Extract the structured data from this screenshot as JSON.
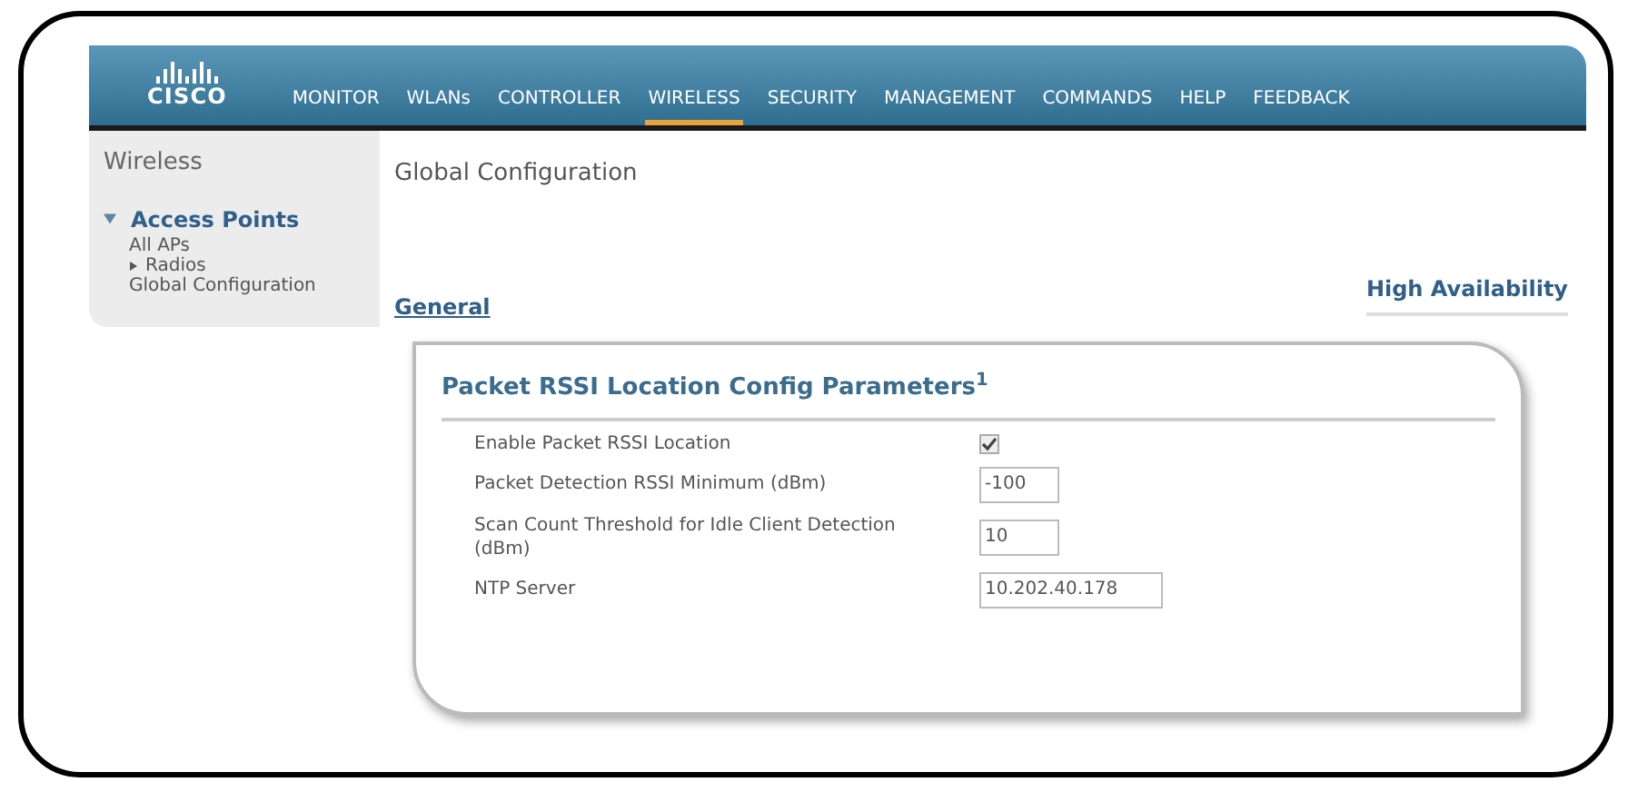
{
  "header": {
    "logo": "CISCO",
    "nav": [
      {
        "label": "MONITOR",
        "selected": false
      },
      {
        "label": "WLANs",
        "selected": false
      },
      {
        "label": "CONTROLLER",
        "selected": false
      },
      {
        "label": "WIRELESS",
        "selected": true
      },
      {
        "label": "SECURITY",
        "selected": false
      },
      {
        "label": "MANAGEMENT",
        "selected": false
      },
      {
        "label": "COMMANDS",
        "selected": false
      },
      {
        "label": "HELP",
        "selected": false
      },
      {
        "label": "FEEDBACK",
        "selected": false
      }
    ]
  },
  "sidebar": {
    "title": "Wireless",
    "items": [
      {
        "label": "Access Points",
        "expanded": true,
        "children": [
          {
            "label": "All APs"
          },
          {
            "label": "Radios",
            "expanded": false
          },
          {
            "label": "Global Configuration"
          }
        ]
      }
    ]
  },
  "page_title": "Global Configuration",
  "section_tabs": [
    {
      "label": "General"
    },
    {
      "label": "High Availability"
    }
  ],
  "panel": {
    "title": "Packet RSSI Location Config Parameters$^{1}$",
    "rows": [
      {
        "kind": "checkbox",
        "label": "Enable Packet RSSI Location",
        "checked": true
      },
      {
        "kind": "input",
        "label": "Packet Detection RSSI Minimum (dBm)",
        "value": "-100"
      },
      {
        "kind": "input",
        "label": "Scan Count Threshold for Idle Client Detection (dBm)",
        "value": "10"
      },
      {
        "kind": "input",
        "label": "NTP Server",
        "value": "10.202.40.178"
      }
    ]
  }
}
